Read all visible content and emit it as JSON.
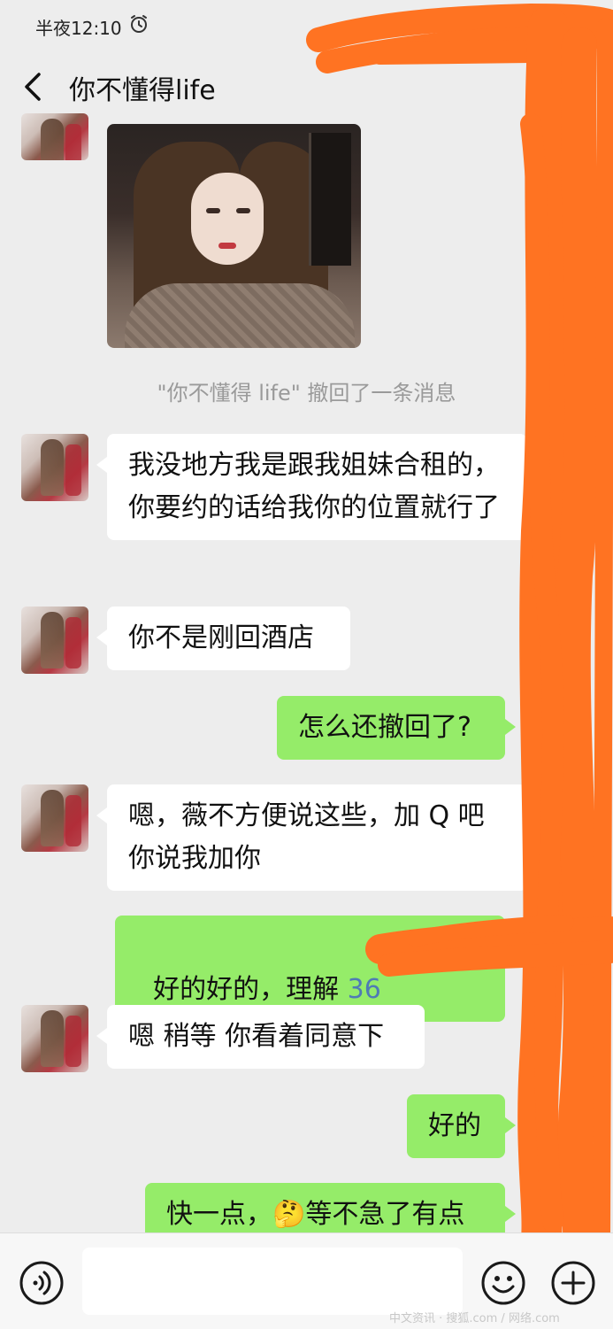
{
  "status_bar": {
    "time": "半夜12:10",
    "icons": [
      "alarm-clock-icon"
    ]
  },
  "header": {
    "title": "你不懂得life",
    "back_icon": "chevron-left-icon"
  },
  "messages": [
    {
      "sender": "contact",
      "type": "image",
      "description_icon": "photo"
    },
    {
      "type": "system",
      "text": "\"你不懂得 life\" 撤回了一条消息"
    },
    {
      "sender": "contact",
      "type": "text",
      "text": "我没地方我是跟我姐妹合租的，你要约的话给我你的位置就行了"
    },
    {
      "sender": "contact",
      "type": "text",
      "text": "你不是刚回酒店"
    },
    {
      "sender": "me",
      "type": "text",
      "text": "怎么还撤回了?"
    },
    {
      "sender": "contact",
      "type": "text",
      "text": "嗯，薇不方便说这些，加 Q 吧 你说我加你"
    },
    {
      "sender": "me",
      "type": "text",
      "text": "好的好的，理解 ",
      "trailing": "36"
    },
    {
      "sender": "contact",
      "type": "text",
      "text": "嗯 稍等 你看着同意下"
    },
    {
      "sender": "me",
      "type": "text",
      "text": "好的"
    },
    {
      "sender": "me",
      "type": "text",
      "text": "快一点，🤔等不急了有点"
    }
  ],
  "input_bar": {
    "voice_icon": "voice-icon",
    "emoji_icon": "emoji-icon",
    "plus_icon": "plus-icon",
    "text_value": ""
  },
  "watermark": "中文资讯 · 搜狐.com / 网络.com",
  "colors": {
    "background": "#ededed",
    "bubble_in": "#ffffff",
    "bubble_out": "#95ec69",
    "redaction": "#ff7322",
    "link_blue": "#4f7bb5"
  }
}
